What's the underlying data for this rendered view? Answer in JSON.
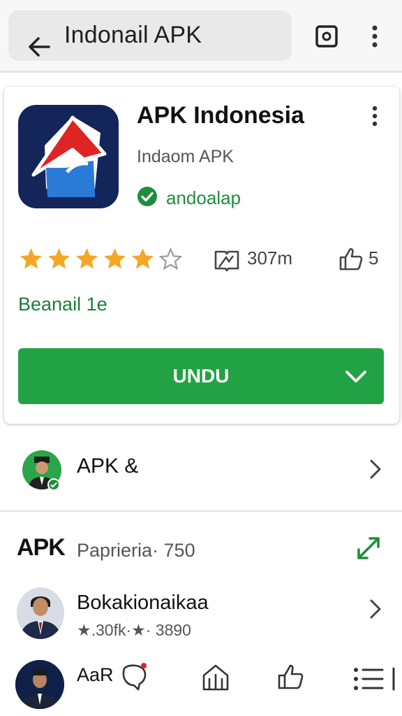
{
  "topbar": {
    "search_text": "Indonail APK",
    "icons": [
      "back-arrow-icon",
      "open-external-icon",
      "more-vert-icon"
    ]
  },
  "app_card": {
    "title": "APK Indonesia",
    "developer": "Indaom APK",
    "verified_label": "andoalap",
    "rating": 5,
    "downloads": "307m",
    "likes": "5",
    "sublink": "Beanail 1e",
    "install_label": "UNDU",
    "colors": {
      "green": "#21a244",
      "star": "#f5a623",
      "icon_bg": "#14255a",
      "red": "#e02424"
    }
  },
  "row1": {
    "label": "APK &"
  },
  "section": {
    "label": "APK",
    "sub": "Paprieria· 750"
  },
  "row3": {
    "title": "Bokakionaikaa",
    "meta": "★.30fk·★· 3890"
  },
  "row4": {
    "label": "AaR"
  },
  "bottom_nav": [
    "chat-icon",
    "home-icon",
    "thumbs-up-icon",
    "list-icon"
  ]
}
